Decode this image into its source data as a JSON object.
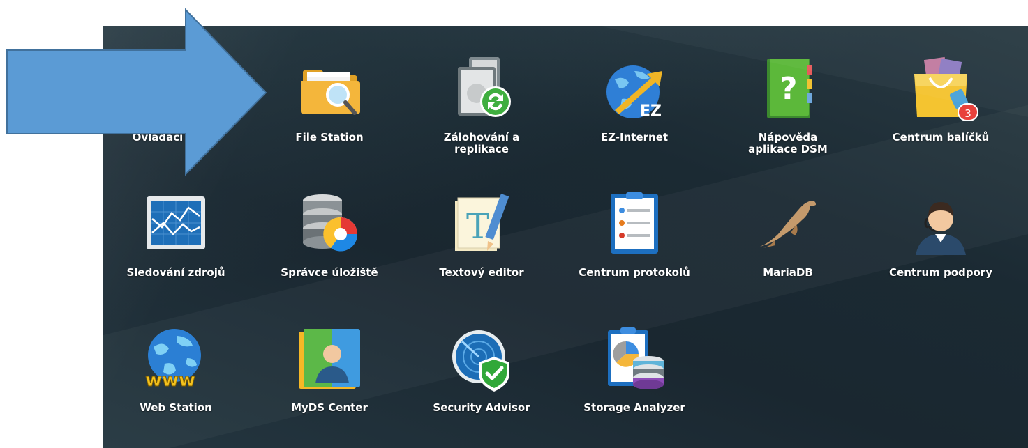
{
  "apps": [
    {
      "name": "Ovládací panel",
      "icon": "control-panel-icon"
    },
    {
      "name": "File Station",
      "icon": "file-station-icon"
    },
    {
      "name": "Zálohování a replikace",
      "icon": "backup-replication-icon"
    },
    {
      "name": "EZ-Internet",
      "icon": "ez-internet-icon"
    },
    {
      "name": "Nápověda aplikace DSM",
      "icon": "dsm-help-icon"
    },
    {
      "name": "Centrum balíčků",
      "icon": "package-center-icon",
      "badge": "3"
    },
    {
      "name": "Sledování zdrojů",
      "icon": "resource-monitor-icon"
    },
    {
      "name": "Správce úložiště",
      "icon": "storage-manager-icon"
    },
    {
      "name": "Textový editor",
      "icon": "text-editor-icon"
    },
    {
      "name": "Centrum protokolů",
      "icon": "log-center-icon"
    },
    {
      "name": "MariaDB",
      "icon": "mariadb-icon"
    },
    {
      "name": "Centrum podpory",
      "icon": "support-center-icon"
    },
    {
      "name": "Web Station",
      "icon": "web-station-icon"
    },
    {
      "name": "MyDS Center",
      "icon": "myds-center-icon"
    },
    {
      "name": "Security Advisor",
      "icon": "security-advisor-icon"
    },
    {
      "name": "Storage Analyzer",
      "icon": "storage-analyzer-icon"
    }
  ],
  "colors": {
    "background": "#1e2d36",
    "arrow": "#5b9bd5",
    "arrow_outline": "#41719c",
    "badge": "#e8413c"
  }
}
